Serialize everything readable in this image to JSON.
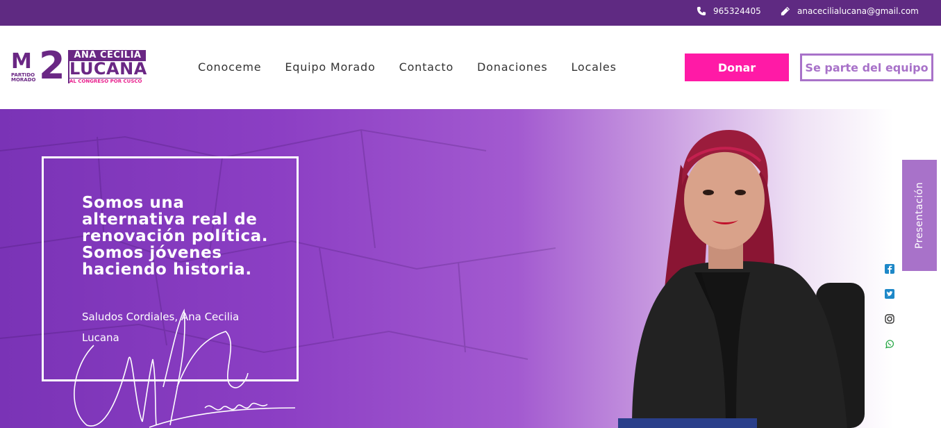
{
  "topbar": {
    "phone": "965324405",
    "email": "anacecilialucana@gmail.com"
  },
  "logo": {
    "m2": "M2",
    "m": "M",
    "two": "2",
    "party_line1": "PARTIDO",
    "party_line2": "MORADO",
    "name_line1": "ANA CECILIA",
    "name_line2": "LUCANA",
    "tagline": "AL CONGRESO POR CUSCO"
  },
  "nav": {
    "items": [
      "Conoceme",
      "Equipo Morado",
      "Contacto",
      "Donaciones",
      "Locales"
    ]
  },
  "buttons": {
    "donar": "Donar",
    "equipo": "Se parte del equipo"
  },
  "hero": {
    "quote": "Somos una alternativa real de renovación política. Somos jóvenes haciendo historia.",
    "greeting": "Saludos Cordiales, Ana Cecilia Lucana"
  },
  "side_tab": {
    "label": "Presentación"
  },
  "social": [
    "facebook-icon",
    "twitter-icon",
    "instagram-icon",
    "whatsapp-icon"
  ],
  "colors": {
    "topbar": "#5f2a82",
    "brand_purple": "#6a2784",
    "donar_pink": "#ff1aa6",
    "lavender": "#a872c9",
    "social_blue": "#1e88c8",
    "whatsapp_green": "#25a744"
  }
}
